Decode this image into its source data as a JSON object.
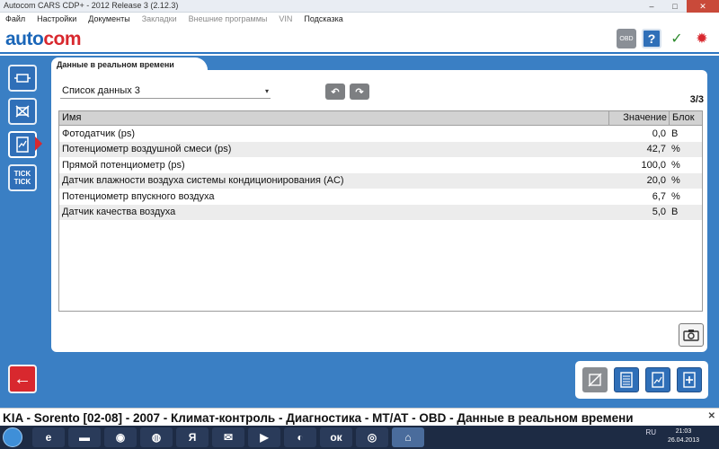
{
  "window": {
    "title": "Autocom CARS CDP+ - 2012 Release 3 (2.12.3)",
    "minimize": "–",
    "maximize": "□",
    "close": "✕"
  },
  "menu": {
    "items": [
      {
        "label": "Файл",
        "enabled": true
      },
      {
        "label": "Настройки",
        "enabled": true
      },
      {
        "label": "Документы",
        "enabled": true
      },
      {
        "label": "Закладки",
        "enabled": false
      },
      {
        "label": "Внешние программы",
        "enabled": false
      },
      {
        "label": "VIN",
        "enabled": false
      },
      {
        "label": "Подсказка",
        "enabled": true
      }
    ]
  },
  "logo": {
    "part1": "auto",
    "part2": "com"
  },
  "top_icons": {
    "obd": "OBD",
    "help": "?",
    "check": "✓",
    "spin": "✹"
  },
  "tab": {
    "title": "Данные в реальном времени"
  },
  "panel": {
    "list_select": "Список данных 3",
    "caret": "▾",
    "back_arrow": "↶",
    "forward_arrow": "↷",
    "page_count": "3/3"
  },
  "table": {
    "columns": {
      "name": "Имя",
      "value": "Значение",
      "unit": "Блок"
    },
    "rows": [
      {
        "name": "Фотодатчик (ps)",
        "value": "0,0",
        "unit": "В"
      },
      {
        "name": "Потенциометр воздушной смеси (ps)",
        "value": "42,7",
        "unit": "%"
      },
      {
        "name": "Прямой потенциометр (ps)",
        "value": "100,0",
        "unit": "%"
      },
      {
        "name": "Датчик влажности воздуха системы кондиционирования (AC)",
        "value": "20,0",
        "unit": "%"
      },
      {
        "name": "Потенциометр впускного воздуха",
        "value": "6,7",
        "unit": "%"
      },
      {
        "name": "Датчик качества воздуха",
        "value": "5,0",
        "unit": "В"
      }
    ]
  },
  "left_nav": {
    "tick_label_1": "TICK",
    "tick_label_2": "TICK"
  },
  "back_button": "←",
  "camera": "📷",
  "status": {
    "breadcrumb": "KIA - Sorento [02-08] - 2007 - Климат-контроль - Диагностика - MT/AT - OBD - Данные в реальном времени",
    "close": "✕"
  },
  "taskbar": {
    "language": "RU",
    "time": "21:03",
    "date": "26.04.2013",
    "apps": [
      {
        "icon": "e"
      },
      {
        "icon": "▬"
      },
      {
        "icon": "◉"
      },
      {
        "icon": "◍"
      },
      {
        "icon": "Я"
      },
      {
        "icon": "✉"
      },
      {
        "icon": "▶"
      },
      {
        "icon": "◐"
      },
      {
        "icon": "ок"
      },
      {
        "icon": "◎"
      },
      {
        "icon": "⌂"
      }
    ]
  }
}
